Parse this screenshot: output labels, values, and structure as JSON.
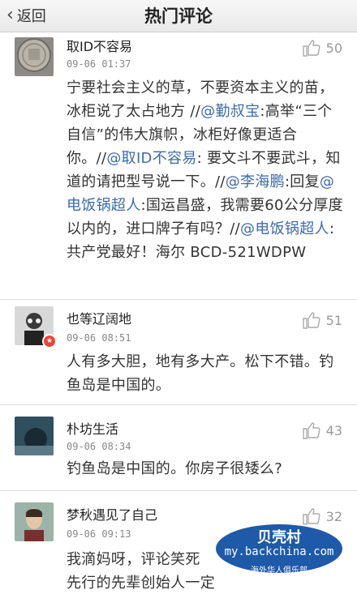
{
  "navbar": {
    "back_label": "返回",
    "title": "热门评论"
  },
  "comments": [
    {
      "username": "取ID不容易",
      "time": "09-06 01:37",
      "likes": "50",
      "body": [
        {
          "t": "宁要社会主义的草，不要资本主义的苗，冰柜说了太占地方 //"
        },
        {
          "t": "@勤叔宝",
          "link": true
        },
        {
          "t": ":高举“三个自信”的伟大旗帜，冰柜好像更适合你。//"
        },
        {
          "t": "@取ID不容易",
          "link": true
        },
        {
          "t": ": 要文斗不要武斗，知道的请把型号说一下。//"
        },
        {
          "t": "@李海鹏",
          "link": true
        },
        {
          "t": ":回复"
        },
        {
          "t": "@电饭锅超人",
          "link": true
        },
        {
          "t": ":国运昌盛，我需要60公分厚度以内的，进口牌子有吗？//"
        },
        {
          "t": "@电饭锅超人",
          "link": true
        },
        {
          "t": ":共产党最好！海尔 BCD-521WDPW"
        }
      ]
    },
    {
      "username": "也等辽阔地",
      "time": "09-06 08:51",
      "likes": "51",
      "body": [
        {
          "t": "人有多大胆，地有多大产。松下不错。钓鱼岛是中国的。"
        }
      ]
    },
    {
      "username": "朴坊生活",
      "time": "09-06 08:34",
      "likes": "43",
      "body": [
        {
          "t": "钓鱼岛是中国的。你房子很矮么?"
        }
      ]
    },
    {
      "username": "梦秋遇见了自己",
      "time": "09-06 09:13",
      "likes": "32",
      "body": [
        {
          "t": "我滴妈呀，评论笑死"
        },
        {
          "t": "先行的先辈创始人一定"
        }
      ]
    }
  ],
  "watermark": {
    "title": "贝壳村",
    "url": "my.backchina.com",
    "subtitle": "海外华人俱乐部"
  },
  "colors": {
    "link": "#3e6ba6",
    "badge": "#e7463a",
    "watermark_bg": "#1e5aa8"
  }
}
